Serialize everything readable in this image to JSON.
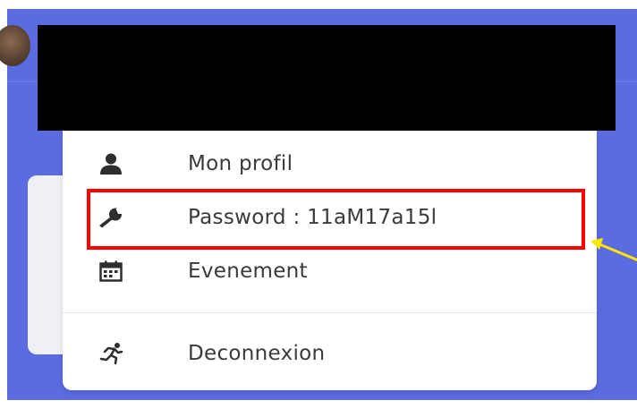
{
  "menu": {
    "items": [
      {
        "label": "Mon profil",
        "icon": "user-icon"
      },
      {
        "label": "Password : 11aM17a15l",
        "icon": "wrench-icon"
      },
      {
        "label": "Evenement",
        "icon": "calendar-icon"
      },
      {
        "label": "Deconnexion",
        "icon": "running-person-icon"
      }
    ]
  },
  "colors": {
    "background": "#5b6be0",
    "menu_background": "#ffffff",
    "text": "#3a3a3a",
    "highlight_box": "#ff0000",
    "annotation_arrow": "#ffe600",
    "redaction": "#000000"
  }
}
